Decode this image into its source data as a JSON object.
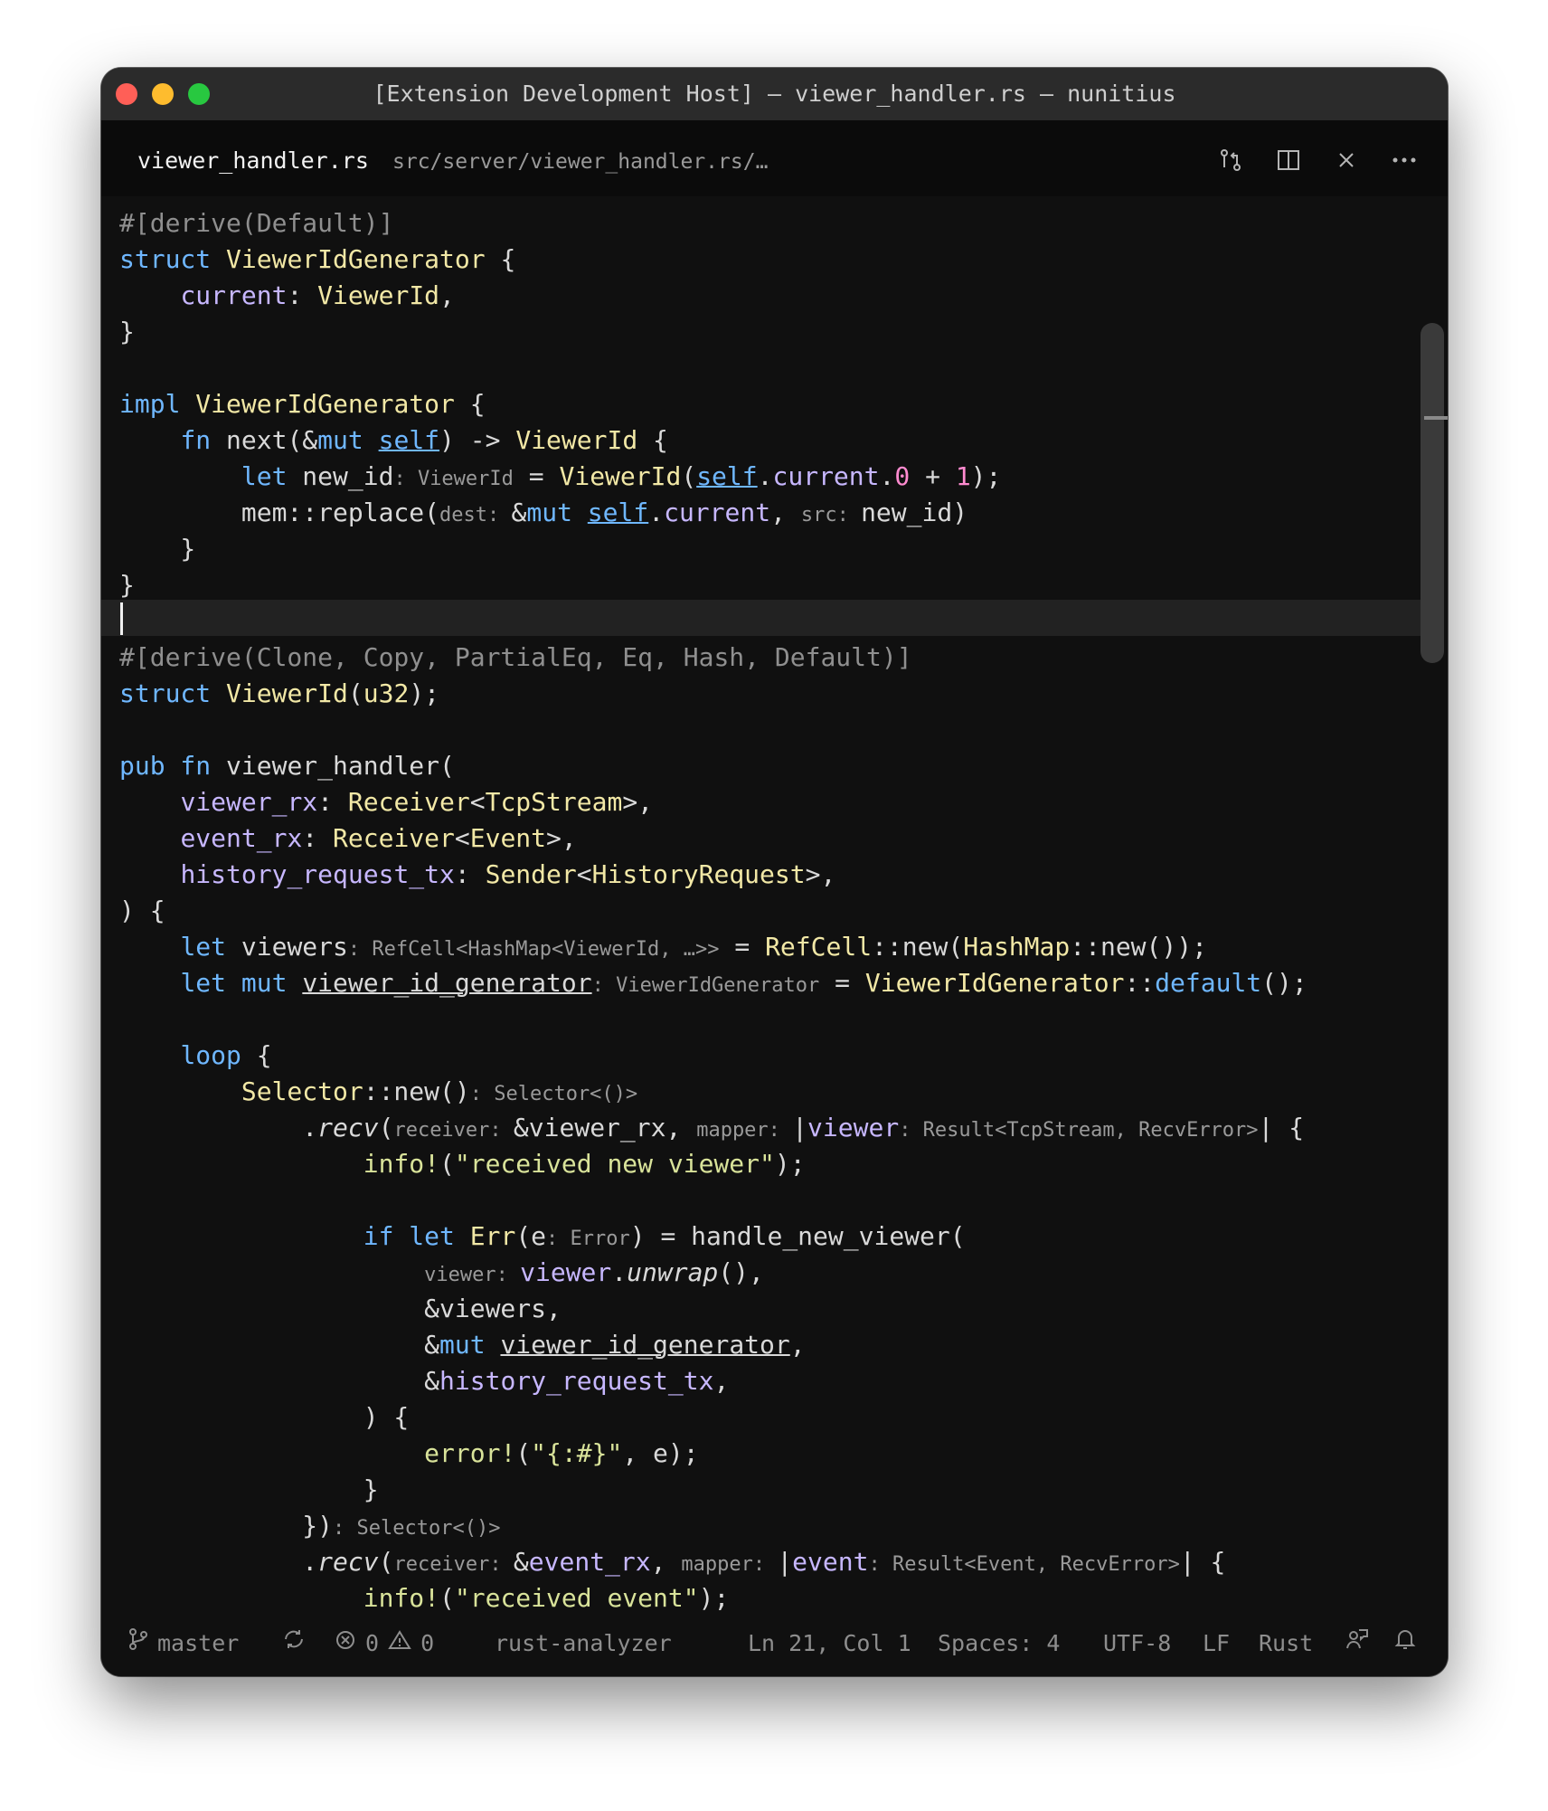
{
  "window": {
    "title": "[Extension Development Host] – viewer_handler.rs — nunitius"
  },
  "tab": {
    "filename": "viewer_handler.rs",
    "path": "src/server/viewer_handler.rs/…",
    "actions": [
      "source-control-icon",
      "split-editor-icon",
      "close-icon",
      "more-icon"
    ]
  },
  "code": {
    "l1": "#[derive(Default)]",
    "l5_impl": "impl",
    "l5_type": "ViewerIdGenerator",
    "l15": "#[derive(Clone, Copy, PartialEq, Eq, Hash, Default)]"
  },
  "status": {
    "branch": "master",
    "errors": "0",
    "warnings": "0",
    "language_server": "rust-analyzer",
    "position": "Ln 21, Col 1",
    "spaces": "Spaces: 4",
    "encoding": "UTF-8",
    "eol": "LF",
    "language": "Rust"
  }
}
